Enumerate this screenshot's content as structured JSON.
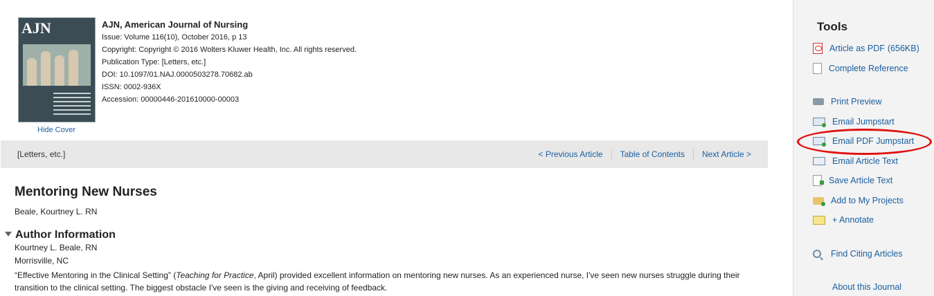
{
  "cover": {
    "logo_text": "AJN",
    "hide_label": "Hide Cover"
  },
  "meta": {
    "journal_title": "AJN, American Journal of Nursing",
    "issue": "Issue: Volume 116(10), October 2016, p 13",
    "copyright": "Copyright: Copyright © 2016 Wolters Kluwer Health, Inc. All rights reserved.",
    "pub_type": "Publication Type: [Letters, etc.]",
    "doi": "DOI: 10.1097/01.NAJ.0000503278.70682.ab",
    "issn": "ISSN: 0002-936X",
    "accession": "Accession: 00000446-201610000-00003"
  },
  "bar": {
    "section": "[Letters, etc.]",
    "prev": "< Previous Article",
    "toc": "Table of Contents",
    "next": "Next Article >"
  },
  "article": {
    "title": "Mentoring New Nurses",
    "byline": "Beale, Kourtney L. RN",
    "author_info_heading": "Author Information",
    "author_name": "Kourtney L. Beale, RN",
    "author_place": "Morrisville, NC",
    "body_part1": "“Effective Mentoring in the Clinical Setting” (",
    "body_italic": "Teaching for Practice",
    "body_part2": ", April) provided excellent information on mentoring new nurses. As an experienced nurse, I've seen new nurses struggle during their transition to the clinical setting. The biggest obstacle I've seen is the giving and receiving of feedback."
  },
  "tools": {
    "title": "Tools",
    "items": [
      {
        "label": "Article as PDF",
        "extra": "(656KB)",
        "icon": "pdf-icon"
      },
      {
        "label": "Complete Reference",
        "icon": "document-icon"
      },
      {
        "label": "Print Preview",
        "icon": "printer-icon"
      },
      {
        "label": "Email Jumpstart",
        "icon": "email-icon"
      },
      {
        "label": "Email PDF Jumpstart",
        "icon": "email-pdf-icon"
      },
      {
        "label": "Email Article Text",
        "icon": "email-open-icon"
      },
      {
        "label": "Save Article Text",
        "icon": "save-icon"
      },
      {
        "label": "Add to My Projects",
        "icon": "folder-add-icon"
      },
      {
        "label": "+ Annotate",
        "icon": "annotate-icon"
      },
      {
        "label": "Find Citing Articles",
        "icon": "magnifier-icon"
      },
      {
        "label": "About this Journal"
      }
    ]
  },
  "colors": {
    "link": "#1a5fa0",
    "highlight": "#e01010",
    "bar_bg": "#e8e8e8",
    "tools_bg": "#f3f3f3"
  }
}
